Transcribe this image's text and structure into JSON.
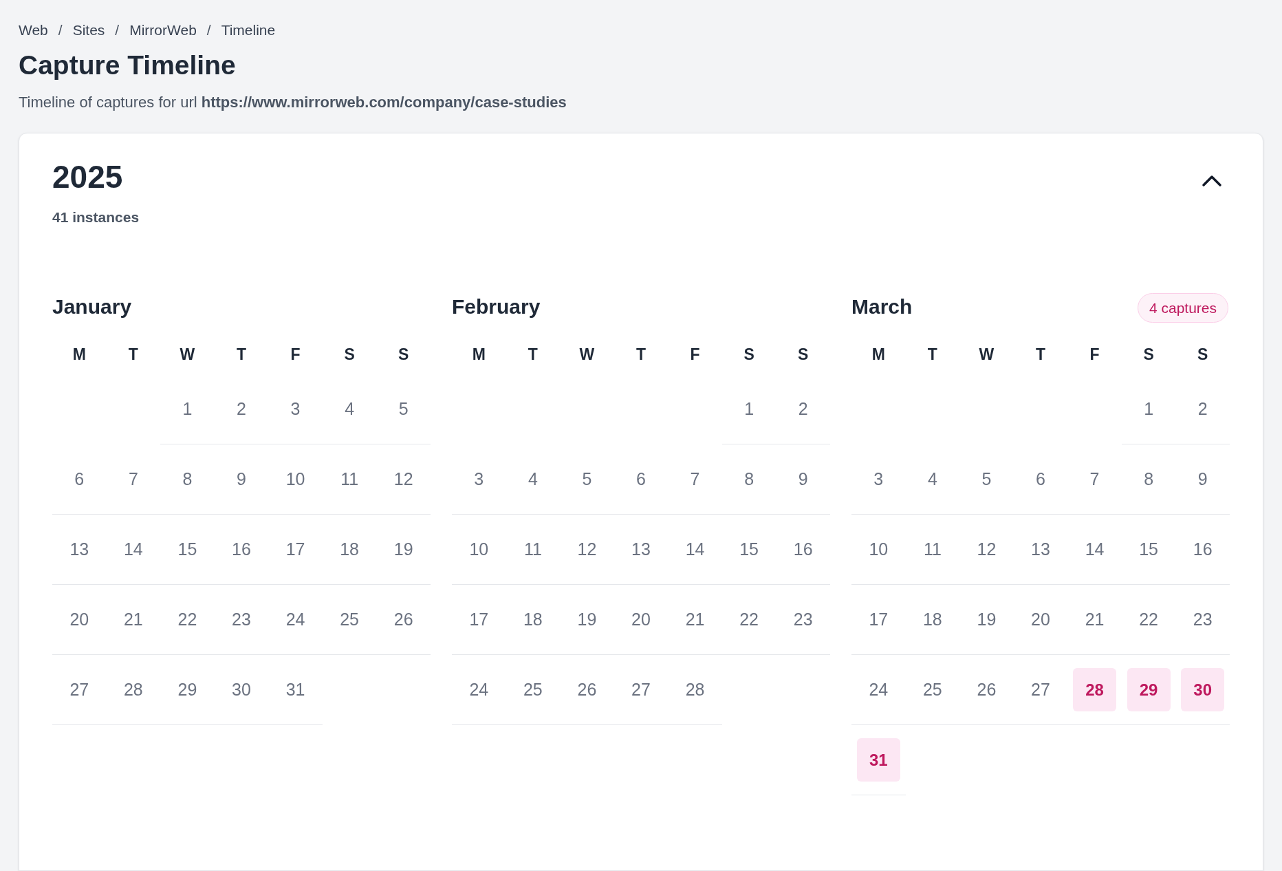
{
  "breadcrumb": [
    {
      "label": "Web"
    },
    {
      "separator": "/",
      "label": "Sites"
    },
    {
      "separator": "/",
      "label": "MirrorWeb"
    },
    {
      "separator": "/",
      "label": "Timeline"
    }
  ],
  "title": "Capture Timeline",
  "subtitle": "Timeline of captures for url **https://www.mirrorweb.com/company/case-studies**",
  "year": {
    "label": "2025",
    "count": "41 instances",
    "expanded": true,
    "months": [
      {
        "name": "January",
        "weekdays": [
          "M",
          "T",
          "W",
          "T",
          "F",
          "S",
          "S"
        ],
        "weeks": [
          [
            {
              "day": "1",
              "captured": false
            },
            {
              "day": "2",
              "captured": false
            },
            {
              "day": "3",
              "captured": false
            },
            {
              "day": "4",
              "captured": false
            },
            {
              "day": "5",
              "captured": false
            }
          ],
          [
            {
              "day": "6",
              "captured": false
            },
            {
              "day": "7",
              "captured": false
            },
            {
              "day": "8",
              "captured": false
            },
            {
              "day": "9",
              "captured": false
            },
            {
              "day": "10",
              "captured": false
            },
            {
              "day": "11",
              "captured": false
            },
            {
              "day": "12",
              "captured": false
            }
          ],
          [
            {
              "day": "13",
              "captured": false
            },
            {
              "day": "14",
              "captured": false
            },
            {
              "day": "15",
              "captured": false
            },
            {
              "day": "16",
              "captured": false
            },
            {
              "day": "17",
              "captured": false
            },
            {
              "day": "18",
              "captured": false
            },
            {
              "day": "19",
              "captured": false
            }
          ],
          [
            {
              "day": "20",
              "captured": false
            },
            {
              "day": "21",
              "captured": false
            },
            {
              "day": "22",
              "captured": false
            },
            {
              "day": "23",
              "captured": false
            },
            {
              "day": "24",
              "captured": false
            },
            {
              "day": "25",
              "captured": false
            },
            {
              "day": "26",
              "captured": false
            }
          ],
          [
            {
              "day": "27",
              "captured": false
            },
            {
              "day": "28",
              "captured": false
            },
            {
              "day": "29",
              "captured": false
            },
            {
              "day": "30",
              "captured": false
            },
            {
              "day": "31",
              "captured": false
            }
          ]
        ]
      },
      {
        "name": "February",
        "weekdays": [
          "M",
          "T",
          "W",
          "T",
          "F",
          "S",
          "S"
        ],
        "weeks": [
          [
            {
              "day": "1",
              "captured": false
            },
            {
              "day": "2",
              "captured": false
            }
          ],
          [
            {
              "day": "3",
              "captured": false
            },
            {
              "day": "4",
              "captured": false
            },
            {
              "day": "5",
              "captured": false
            },
            {
              "day": "6",
              "captured": false
            },
            {
              "day": "7",
              "captured": false
            },
            {
              "day": "8",
              "captured": false
            },
            {
              "day": "9",
              "captured": false
            }
          ],
          [
            {
              "day": "10",
              "captured": false
            },
            {
              "day": "11",
              "captured": false
            },
            {
              "day": "12",
              "captured": false
            },
            {
              "day": "13",
              "captured": false
            },
            {
              "day": "14",
              "captured": false
            },
            {
              "day": "15",
              "captured": false
            },
            {
              "day": "16",
              "captured": false
            }
          ],
          [
            {
              "day": "17",
              "captured": false
            },
            {
              "day": "18",
              "captured": false
            },
            {
              "day": "19",
              "captured": false
            },
            {
              "day": "20",
              "captured": false
            },
            {
              "day": "21",
              "captured": false
            },
            {
              "day": "22",
              "captured": false
            },
            {
              "day": "23",
              "captured": false
            }
          ],
          [
            {
              "day": "24",
              "captured": false
            },
            {
              "day": "25",
              "captured": false
            },
            {
              "day": "26",
              "captured": false
            },
            {
              "day": "27",
              "captured": false
            },
            {
              "day": "28",
              "captured": false
            }
          ]
        ]
      },
      {
        "name": "March",
        "badge": "4 captures",
        "weekdays": [
          "M",
          "T",
          "W",
          "T",
          "F",
          "S",
          "S"
        ],
        "weeks": [
          [
            {
              "day": "1",
              "captured": false
            },
            {
              "day": "2",
              "captured": false
            }
          ],
          [
            {
              "day": "3",
              "captured": false
            },
            {
              "day": "4",
              "captured": false
            },
            {
              "day": "5",
              "captured": false
            },
            {
              "day": "6",
              "captured": false
            },
            {
              "day": "7",
              "captured": false
            },
            {
              "day": "8",
              "captured": false
            },
            {
              "day": "9",
              "captured": false
            }
          ],
          [
            {
              "day": "10",
              "captured": false
            },
            {
              "day": "11",
              "captured": false
            },
            {
              "day": "12",
              "captured": false
            },
            {
              "day": "13",
              "captured": false
            },
            {
              "day": "14",
              "captured": false
            },
            {
              "day": "15",
              "captured": false
            },
            {
              "day": "16",
              "captured": false
            }
          ],
          [
            {
              "day": "17",
              "captured": false
            },
            {
              "day": "18",
              "captured": false
            },
            {
              "day": "19",
              "captured": false
            },
            {
              "day": "20",
              "captured": false
            },
            {
              "day": "21",
              "captured": false
            },
            {
              "day": "22",
              "captured": false
            },
            {
              "day": "23",
              "captured": false
            }
          ],
          [
            {
              "day": "24",
              "captured": false
            },
            {
              "day": "25",
              "captured": false
            },
            {
              "day": "26",
              "captured": false
            },
            {
              "day": "27",
              "captured": false
            },
            {
              "day": "28",
              "captured": true
            },
            {
              "day": "29",
              "captured": true
            },
            {
              "day": "30",
              "captured": true
            }
          ],
          [
            {
              "day": "31",
              "captured": true
            }
          ]
        ]
      }
    ]
  }
}
